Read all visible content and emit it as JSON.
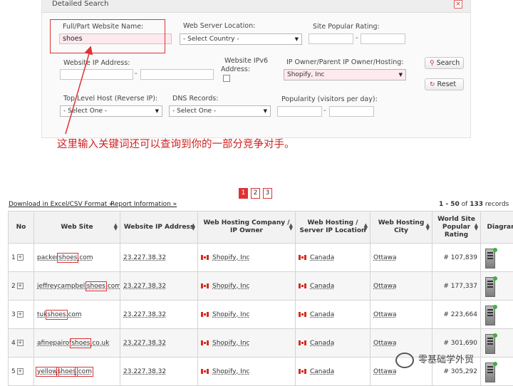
{
  "panel": {
    "title": "Detailed Search",
    "close": "×"
  },
  "form": {
    "name_label": "Full/Part Website Name:",
    "name_value": "shoes",
    "server_loc_label": "Web Server Location:",
    "country_select": "- Select Country -",
    "popular_label": "Site Popular Rating:",
    "ip_label": "Website IP Address:",
    "ipv6_label_1": "Website IPv6",
    "ipv6_label_2": "Address:",
    "owner_label": "IP Owner/Parent IP Owner/Hosting:",
    "owner_value": "Shopify, Inc",
    "search_btn": "Search",
    "reset_btn": "Reset",
    "tld_label": "Top Level Host (Reverse IP):",
    "tld_select": "- Select One -",
    "dns_label": "DNS Records:",
    "dns_select": "- Select One -",
    "popularity_label": "Popularity (visitors per day):",
    "dash": "-"
  },
  "annotation": "这里输入关键词还可以查询到你的一部分竞争对手。",
  "pagination": [
    "1",
    "2",
    "3"
  ],
  "links": {
    "download": "Download in Excel/CSV Format »",
    "report": "Report Information »"
  },
  "records": {
    "range": "1 - 50",
    "of": "of",
    "total": "133",
    "suffix": "records"
  },
  "table": {
    "headers": [
      "No",
      "Web Site",
      "Website IP Address",
      "Web Hosting Company / IP Owner",
      "Web Hosting / Server IP Location",
      "Web Hosting City",
      "World Site Popular Rating",
      "Diagram"
    ],
    "rows": [
      {
        "no": "1",
        "site_pre": "packer",
        "site_kw": "shoes",
        "site_post": ".com",
        "ip": "23.227.38.32",
        "company": "Shopify, Inc",
        "country": "Canada",
        "city": "Ottawa",
        "rating": "# 107,839"
      },
      {
        "no": "2",
        "site_pre": "jeffreycampbell",
        "site_kw": "shoes",
        "site_post": ".com",
        "ip": "23.227.38.32",
        "company": "Shopify, Inc",
        "country": "Canada",
        "city": "Ottawa",
        "rating": "# 177,337"
      },
      {
        "no": "3",
        "site_pre": "tuk",
        "site_kw": "shoes",
        "site_post": ".com",
        "ip": "23.227.38.32",
        "company": "Shopify, Inc",
        "country": "Canada",
        "city": "Ottawa",
        "rating": "# 223,664"
      },
      {
        "no": "4",
        "site_pre": "afinepairof",
        "site_kw": "shoes",
        "site_post": ".co.uk",
        "ip": "23.227.38.32",
        "company": "Shopify, Inc",
        "country": "Canada",
        "city": "Ottawa",
        "rating": "# 301,690"
      },
      {
        "no": "5",
        "site_pre": "yellow",
        "site_kw": "shoes",
        "site_post": ".com",
        "ip": "23.227.38.32",
        "company": "Shopify, Inc",
        "country": "Canada",
        "city": "Ottawa",
        "rating": "# 305,292"
      }
    ]
  },
  "watermark": "零基础学外贸"
}
